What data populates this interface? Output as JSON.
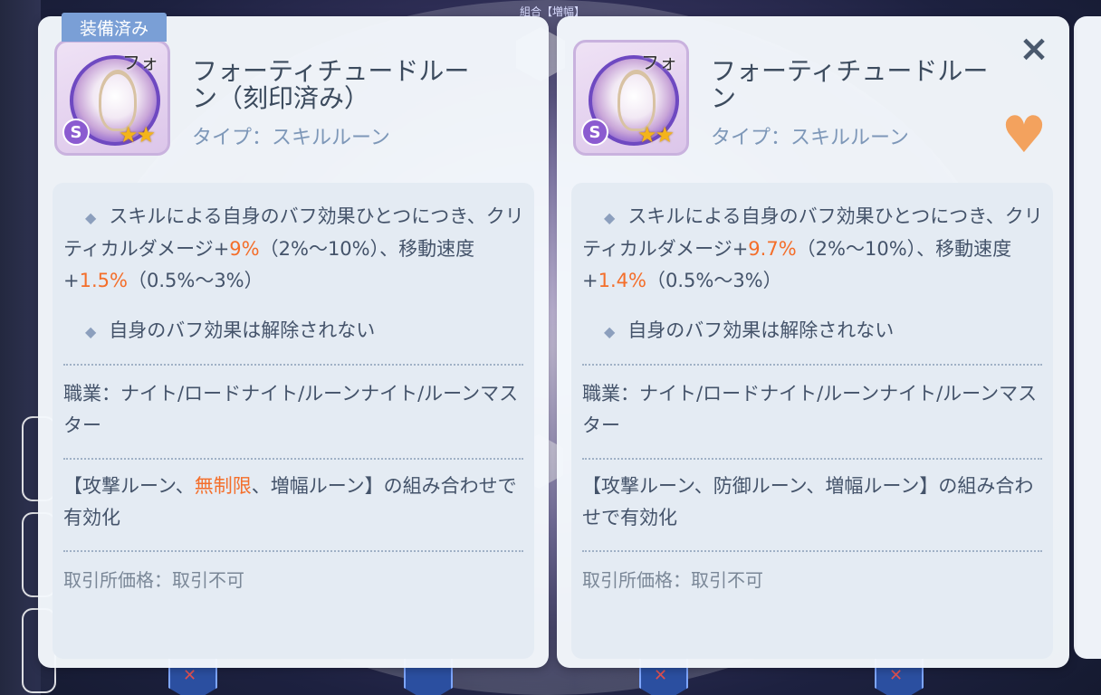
{
  "background": {
    "banner_text": "組合【増幅】"
  },
  "left_card": {
    "equipped_tag": "装備済み",
    "icon_label": "フォ",
    "rank": "S",
    "stars": "★★",
    "name": "フォーティチュードルーン（刻印済み）",
    "type": "タイプ：スキルルーン",
    "effect1_pre": "スキルによる自身のバフ効果ひとつにつき、クリティカルダメージ+",
    "effect1_crit": "9%",
    "effect1_mid": "（2%～10%）、移動速度+",
    "effect1_speed": "1.5%",
    "effect1_post": "（0.5%～3%）",
    "effect2": "自身のバフ効果は解除されない",
    "jobs": "職業：ナイト/ロードナイト/ルーンナイト/ルーンマスター",
    "combo_pre": "【攻撃ルーン、",
    "combo_hl": "無制限",
    "combo_post": "、増幅ルーン】の組み合わせで有効化",
    "price": "取引所価格：取引不可"
  },
  "right_card": {
    "icon_label": "フォ",
    "rank": "S",
    "stars": "★★",
    "name": "フォーティチュードルーン",
    "type": "タイプ：スキルルーン",
    "effect1_pre": "スキルによる自身のバフ効果ひとつにつき、クリティカルダメージ+",
    "effect1_crit": "9.7%",
    "effect1_mid": "（2%～10%）、移動速度+",
    "effect1_speed": "1.4%",
    "effect1_post": "（0.5%～3%）",
    "effect2": "自身のバフ効果は解除されない",
    "jobs": "職業：ナイト/ロードナイト/ルーンナイト/ルーンマスター",
    "combo": "【攻撃ルーン、防御ルーン、増幅ルーン】の組み合わせで有効化",
    "price": "取引所価格：取引不可",
    "close_icon": "×",
    "favorite_icon": "♥"
  },
  "colors": {
    "highlight": "#f46e2a",
    "text": "#44536a",
    "accent_tag": "#7a9fd6",
    "heart": "#f3a25e"
  }
}
